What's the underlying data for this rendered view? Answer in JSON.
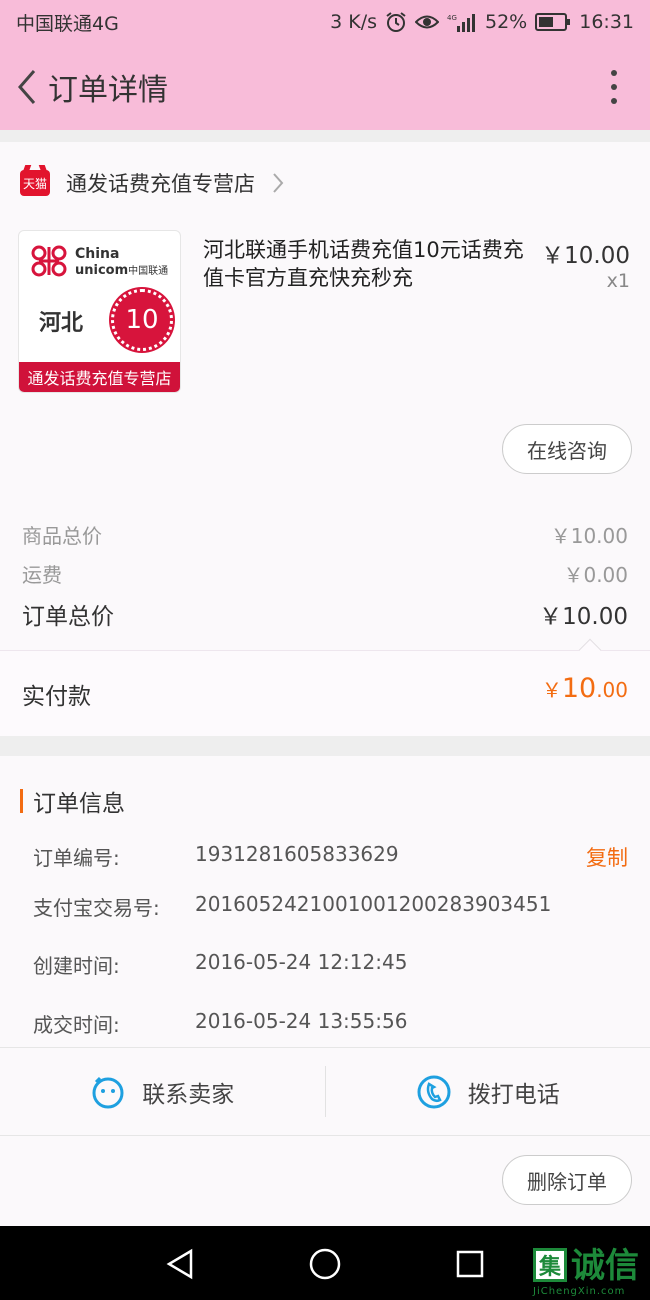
{
  "status_bar": {
    "carrier": "中国联通4G",
    "speed": "3 K/s",
    "battery": "52%",
    "time": "16:31"
  },
  "header": {
    "title": "订单详情"
  },
  "shop": {
    "badge": "天猫",
    "name": "通发话费充值专营店"
  },
  "product": {
    "thumb_brand_line1": "China",
    "thumb_brand_line2": "unicom",
    "thumb_brand_cn": "中国联通",
    "thumb_province": "河北",
    "thumb_value": "10",
    "thumb_banner": "通发话费充值专营店",
    "title": "河北联通手机话费充值10元话费充值卡官方直充快充秒充",
    "price": "￥10.00",
    "quantity": "x1"
  },
  "consult_button": "在线咨询",
  "summary": {
    "goods_total_label": "商品总价",
    "goods_total_value": "￥10.00",
    "shipping_label": "运费",
    "shipping_value": "￥0.00",
    "order_total_label": "订单总价",
    "order_total_value": "￥10.00",
    "paid_label": "实付款",
    "paid_currency": "￥",
    "paid_integer": "10",
    "paid_decimal": ".00"
  },
  "order_info": {
    "heading": "订单信息",
    "rows": [
      {
        "label": "订单编号:",
        "value": "1931281605833629"
      },
      {
        "label": "支付宝交易号:",
        "value": "2016052421001001200283903451"
      },
      {
        "label": "创建时间:",
        "value": "2016-05-24 12:12:45"
      },
      {
        "label": "成交时间:",
        "value": "2016-05-24 13:55:56"
      }
    ],
    "copy_label": "复制"
  },
  "actions": {
    "contact_seller": "联系卖家",
    "call_phone": "拨打电话",
    "delete_order": "删除订单"
  },
  "watermark": {
    "box_char": "集",
    "text": "诚信",
    "sub": "JiChengXin.com"
  },
  "colors": {
    "header_bg": "#f8bcd9",
    "accent_orange": "#f36c12",
    "tmall_red": "#e2142d",
    "icon_blue": "#1ea0e0"
  }
}
